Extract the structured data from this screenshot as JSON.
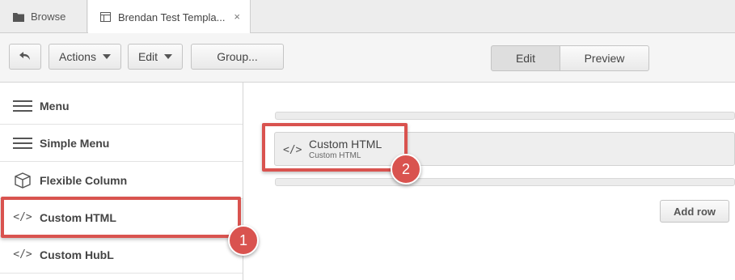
{
  "tabs": {
    "browse": {
      "label": "Browse",
      "icon": "folder-icon"
    },
    "template": {
      "label": "Brendan Test Templa...",
      "icon": "template-icon",
      "close": "×"
    }
  },
  "toolbar": {
    "back_icon": "back-arrow-icon",
    "actions_label": "Actions",
    "edit_menu_label": "Edit",
    "group_label": "Group...",
    "mode_edit_label": "Edit",
    "mode_preview_label": "Preview"
  },
  "sidebar": {
    "items": [
      {
        "label": "Menu",
        "icon": "hamburger-icon"
      },
      {
        "label": "Simple Menu",
        "icon": "hamburger-icon"
      },
      {
        "label": "Flexible Column",
        "icon": "cube-icon"
      },
      {
        "label": "Custom HTML",
        "icon": "code-icon"
      },
      {
        "label": "Custom HubL",
        "icon": "code-icon"
      }
    ]
  },
  "main": {
    "module": {
      "title": "Custom HTML",
      "subtitle": "Custom HTML",
      "icon": "code-icon"
    },
    "add_row_label": "Add row"
  },
  "annotations": {
    "badge_1": "1",
    "badge_2": "2",
    "color": "#d9534f"
  },
  "colors": {
    "tabbar_bg": "#ededed",
    "toolbar_bg": "#f5f5f5",
    "active_segment_bg": "#dedede"
  }
}
